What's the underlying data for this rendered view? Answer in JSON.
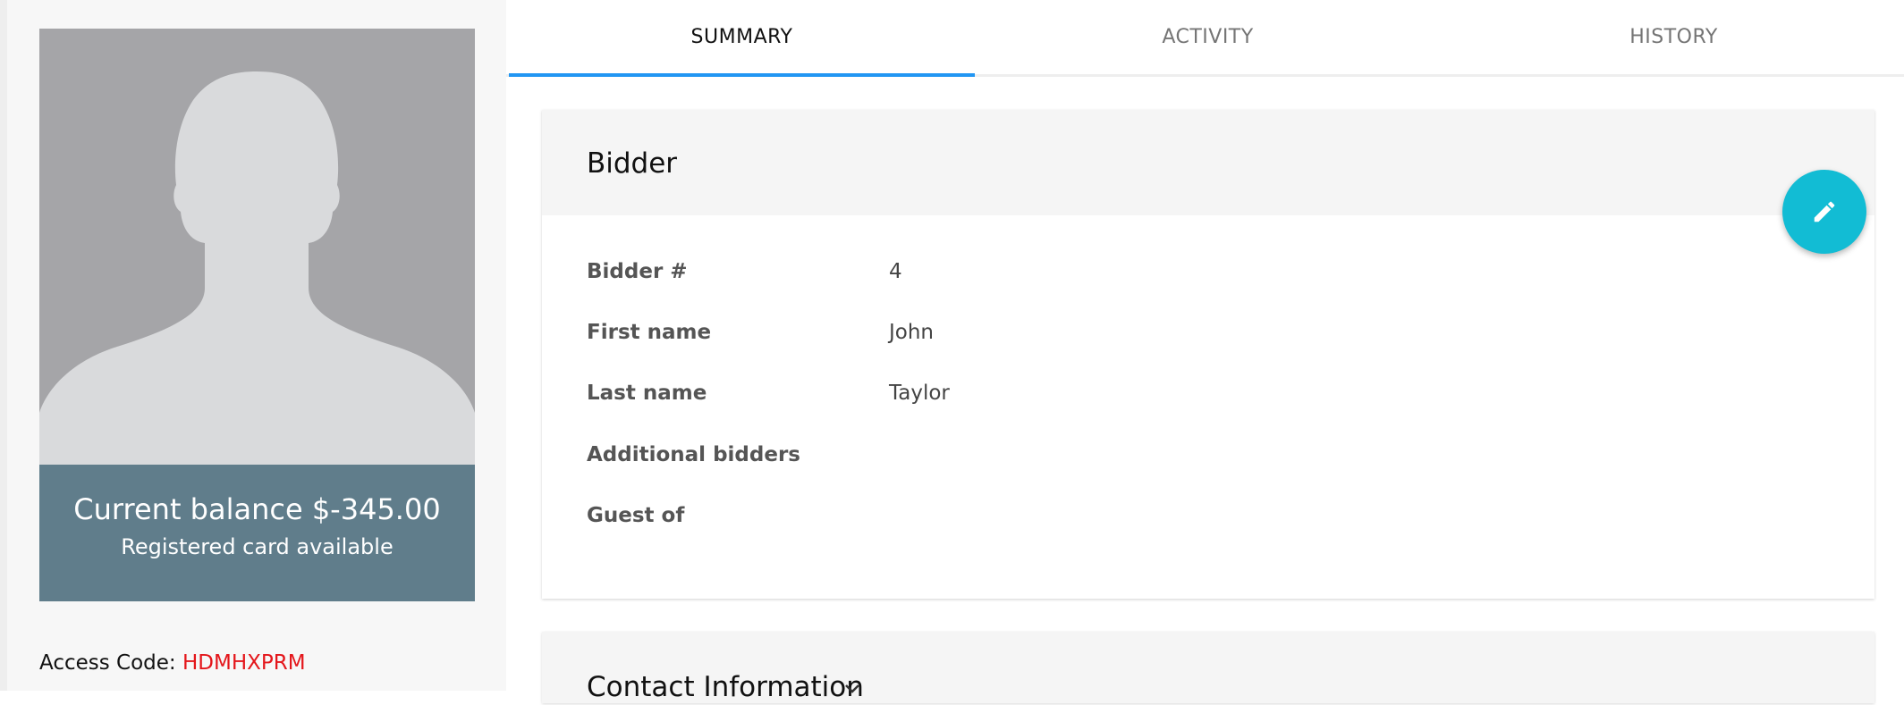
{
  "profile": {
    "balance_text": "Current balance $-345.00",
    "card_text": "Registered card available",
    "access_code_label": "Access Code:",
    "access_code_value": "HDMHXPRM",
    "avatar_icon": "person-silhouette-icon"
  },
  "tabs": [
    {
      "label": "SUMMARY",
      "active": true
    },
    {
      "label": "ACTIVITY",
      "active": false
    },
    {
      "label": "HISTORY",
      "active": false
    }
  ],
  "bidder": {
    "title": "Bidder",
    "edit_icon": "pencil-icon",
    "fields": [
      {
        "label": "Bidder #",
        "value": "4"
      },
      {
        "label": "First name",
        "value": "John"
      },
      {
        "label": "Last name",
        "value": "Taylor"
      },
      {
        "label": "Additional bidders",
        "value": ""
      },
      {
        "label": "Guest of",
        "value": ""
      }
    ]
  },
  "contact": {
    "title": "Contact Information",
    "icon": "chevron-down-icon"
  },
  "colors": {
    "accent_tab": "#2196f3",
    "fab": "#12bcd4",
    "balance_bg": "#607d8b",
    "access_code": "#e4161b"
  }
}
